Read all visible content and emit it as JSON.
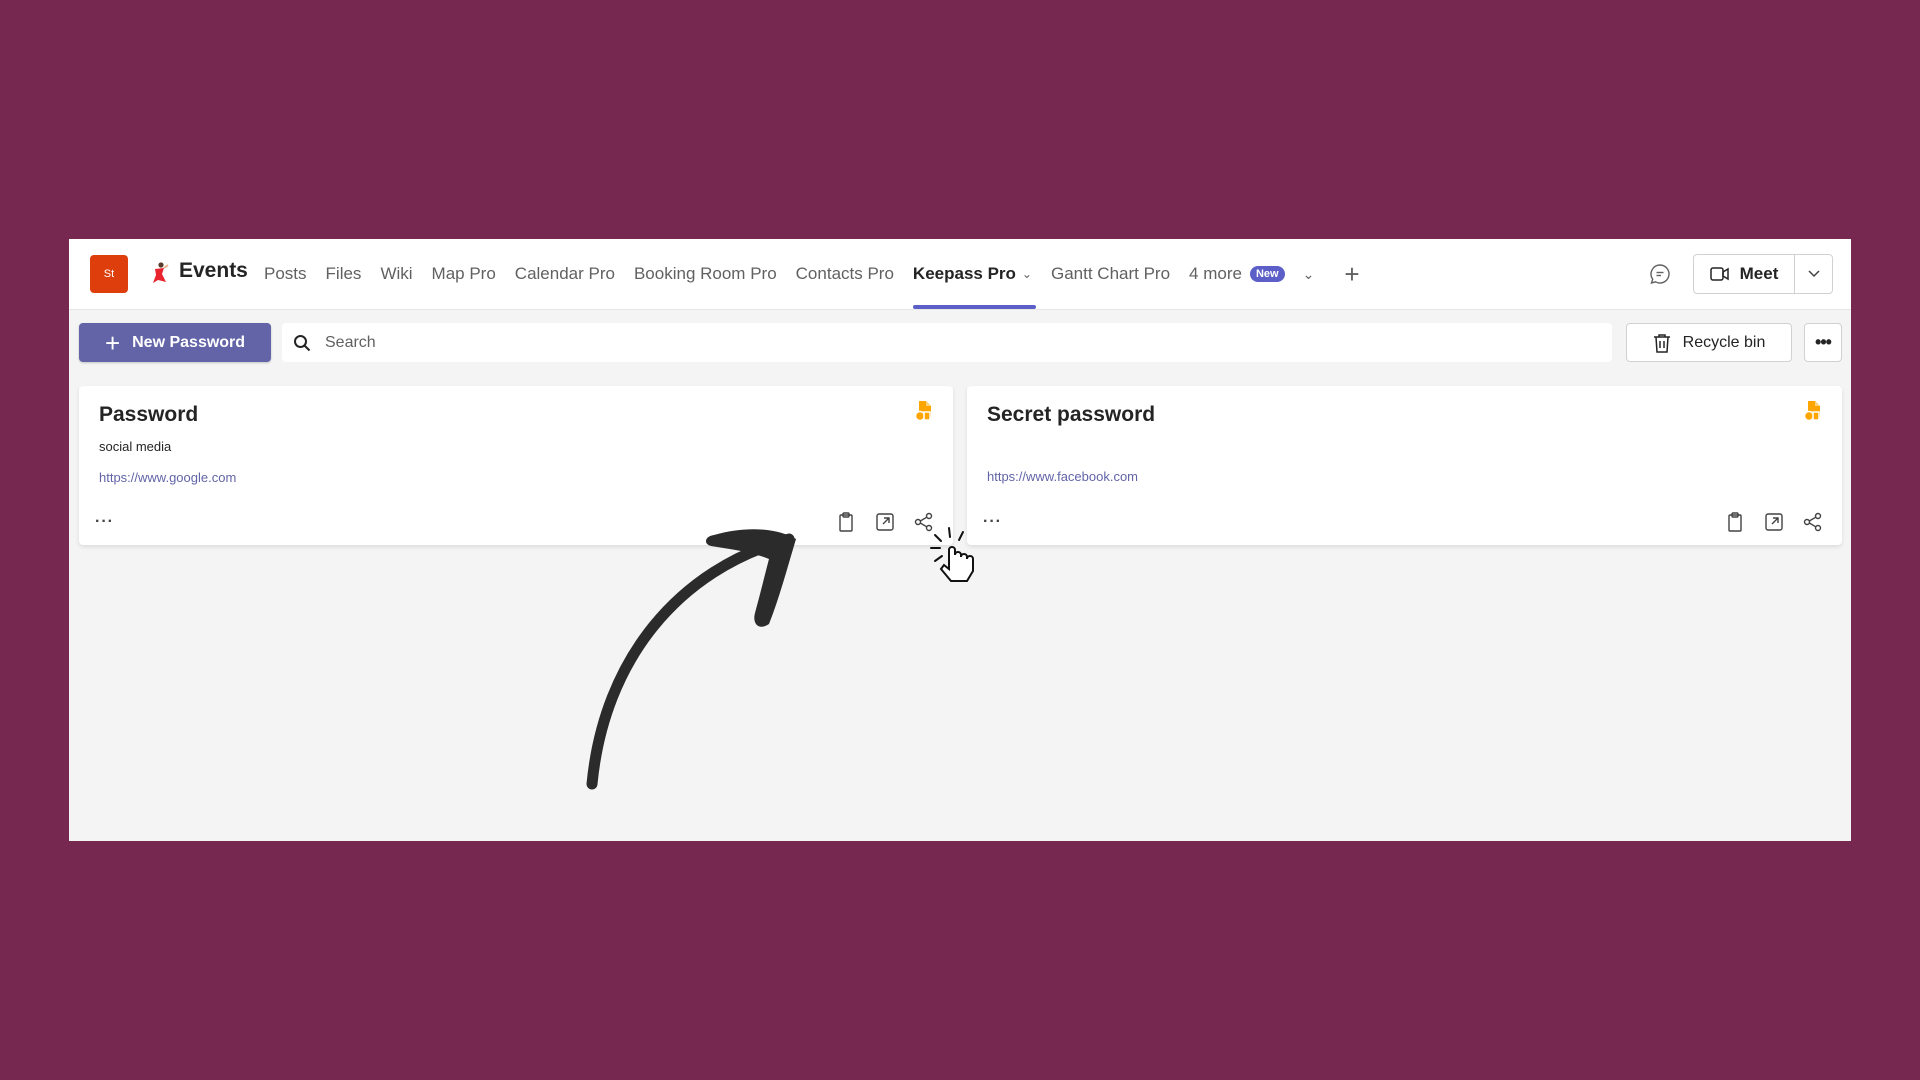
{
  "header": {
    "team_avatar": "St",
    "channel_icon": "dancer-icon",
    "channel_name": "Events",
    "tabs": [
      {
        "label": "Posts"
      },
      {
        "label": "Files"
      },
      {
        "label": "Wiki"
      },
      {
        "label": "Map Pro"
      },
      {
        "label": "Calendar Pro"
      },
      {
        "label": "Booking Room Pro"
      },
      {
        "label": "Contacts Pro"
      },
      {
        "label": "Keepass Pro",
        "active": true
      },
      {
        "label": "Gantt Chart Pro"
      }
    ],
    "more_tabs_label": "4 more",
    "new_badge": "New",
    "meet_label": "Meet"
  },
  "toolbar": {
    "new_password_label": "New Password",
    "search_placeholder": "Search",
    "recycle_bin_label": "Recycle bin"
  },
  "cards": [
    {
      "title": "Password",
      "description": "social media",
      "url": "https://www.google.com"
    },
    {
      "title": "Secret password",
      "description": "",
      "url": "https://www.facebook.com"
    }
  ],
  "colors": {
    "background": "#772850",
    "accent": "#6264a7",
    "badge": "#ffa500",
    "team_avatar": "#dd3e0c"
  }
}
